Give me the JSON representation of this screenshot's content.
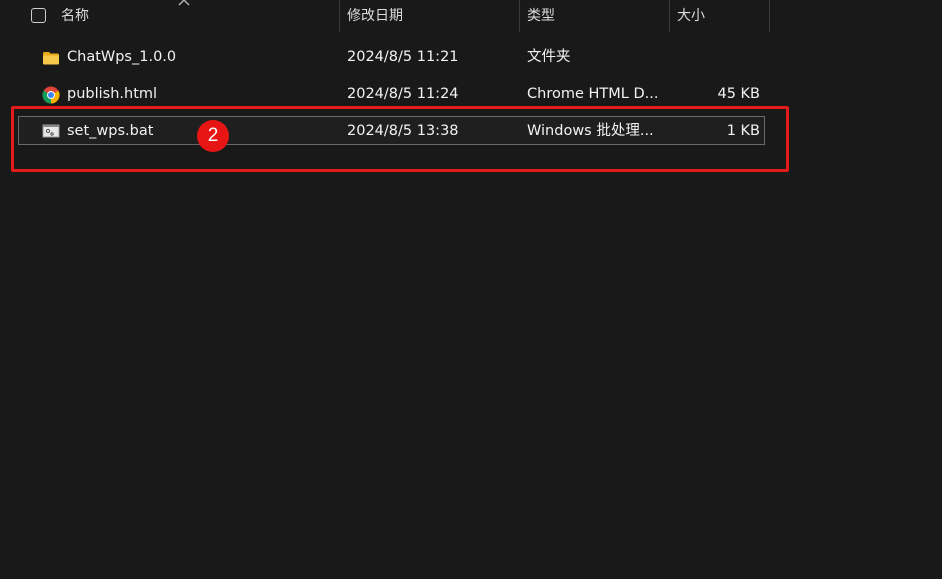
{
  "header": {
    "name_label": "名称",
    "date_label": "修改日期",
    "type_label": "类型",
    "size_label": "大小"
  },
  "files": [
    {
      "icon": "folder-icon",
      "name": "ChatWps_1.0.0",
      "date": "2024/8/5 11:21",
      "type": "文件夹",
      "size": ""
    },
    {
      "icon": "chrome-icon",
      "name": "publish.html",
      "date": "2024/8/5 11:24",
      "type": "Chrome HTML D...",
      "size": "45 KB"
    },
    {
      "icon": "batch-file-icon",
      "name": "set_wps.bat",
      "date": "2024/8/5 13:38",
      "type": "Windows 批处理...",
      "size": "1 KB"
    }
  ],
  "annotation": {
    "badge_text": "2",
    "color": "#e51b1b"
  },
  "colors": {
    "background": "#191919",
    "text": "#f2f2f2",
    "folder": "#f5c242"
  }
}
